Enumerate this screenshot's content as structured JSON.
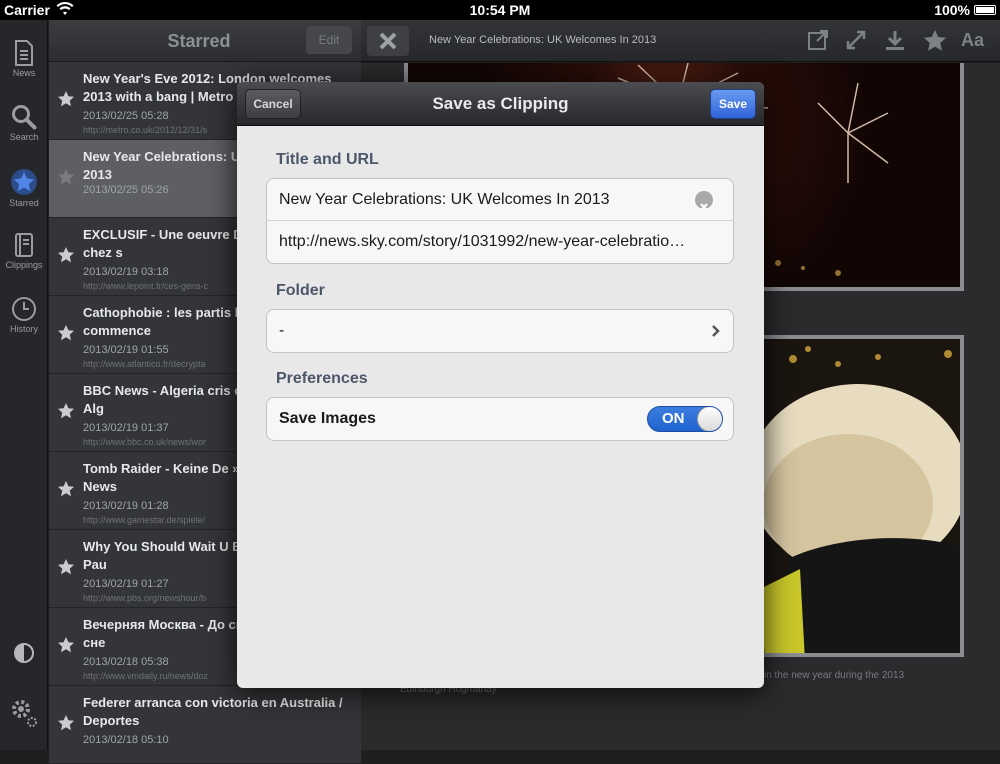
{
  "status_bar": {
    "carrier": "Carrier",
    "time": "10:54 PM",
    "battery": "100%"
  },
  "left_nav": [
    {
      "label": "News",
      "icon": "document-icon"
    },
    {
      "label": "Search",
      "icon": "search-icon"
    },
    {
      "label": "Starred",
      "icon": "star-icon"
    },
    {
      "label": "Clippings",
      "icon": "book-icon"
    },
    {
      "label": "History",
      "icon": "clock-icon"
    }
  ],
  "list": {
    "title": "Starred",
    "edit_label": "Edit",
    "items": [
      {
        "title": "New Year's Eve 2012: London welcomes 2013 with a bang | Metro",
        "date": "2013/02/25 05:28",
        "url": "http://metro.co.uk/2012/12/31/s"
      },
      {
        "title": "New Year Celebrations: UK Welcomes In 2013",
        "date": "2013/02/25 05:26",
        "url": ""
      },
      {
        "title": "EXCLUSIF - Une oeuvre Delarue dérobée chez s",
        "date": "2013/02/19 03:18",
        "url": "http://www.lepoint.fr/ces-gens-c"
      },
      {
        "title": "Cathophobie : les partis homosexuel commence",
        "date": "2013/02/19 01:55",
        "url": "http://www.atlantico.fr/decrypta"
      },
      {
        "title": "BBC News - Algeria cris casualties feared in Alg",
        "date": "2013/02/19 01:37",
        "url": "http://www.bbc.co.uk/news/wor"
      },
      {
        "title": "Tomb Raider - Keine De »Spoiler-Gefahr« - News",
        "date": "2013/02/19 01:28",
        "url": "http://www.gamestar.de/spiele/"
      },
      {
        "title": " Why You Should Wait U Business Desk with Pau",
        "date": "2013/02/19 01:27",
        "url": "http://www.pbs.org/newshour/b"
      },
      {
        "title": "Вечерняя Москва - До сменился мокрым сне",
        "date": "2013/02/18 05:38",
        "url": "http://www.vmdaily.ru/news/doz"
      },
      {
        "title": "Federer arranca con victoria en Australia / Deportes",
        "date": "2013/02/18 05:10",
        "url": ""
      }
    ]
  },
  "toolbar": {
    "article_title": "New Year Celebrations: UK Welcomes In 2013",
    "font_label": "Aa"
  },
  "article": {
    "caption_left": "Edinburgh Hogmanay",
    "caption_right": "in the new year during the 2013"
  },
  "modal": {
    "title": "Save as Clipping",
    "cancel_label": "Cancel",
    "save_label": "Save",
    "section_title_url": "Title and URL",
    "title_value": "New Year Celebrations: UK Welcomes In 2013",
    "url_value": "http://news.sky.com/story/1031992/new-year-celebratio…",
    "section_folder": "Folder",
    "folder_value": "-",
    "section_preferences": "Preferences",
    "save_images_label": "Save Images",
    "toggle_label": "ON",
    "save_images_on": true
  },
  "colors": {
    "accent": "#2f63d9",
    "section": "#4d576b"
  }
}
